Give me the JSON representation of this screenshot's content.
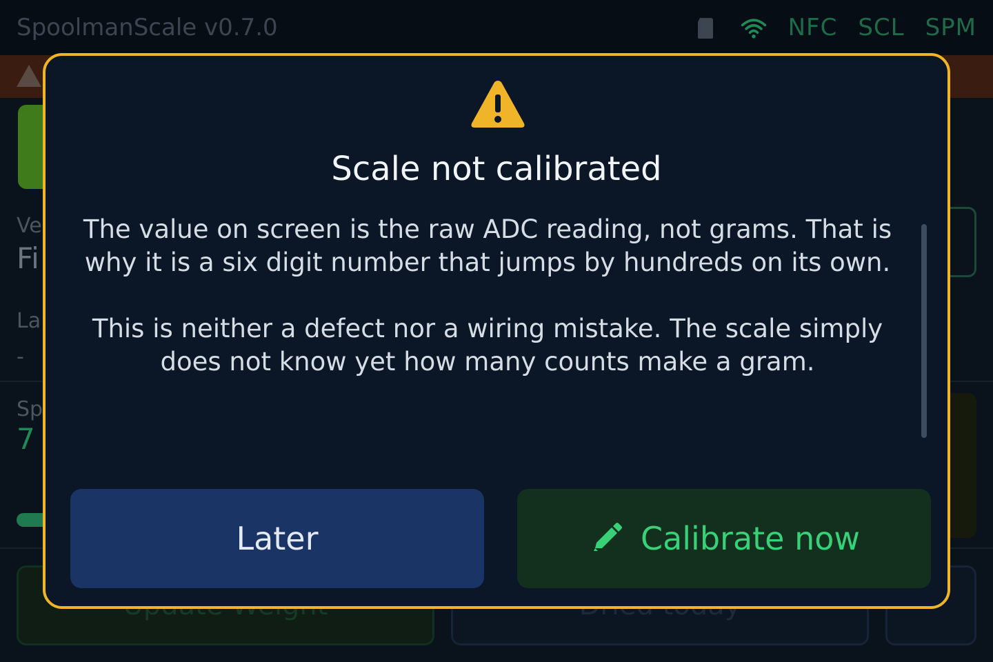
{
  "topbar": {
    "app_title": "SpoolmanScale v0.7.0",
    "status": [
      "NFC",
      "SCL",
      "SPM"
    ]
  },
  "icons": {
    "sd_card": "sd-card-icon",
    "wifi": "wifi-icon",
    "warning": "warning-icon",
    "pencil": "pencil-icon"
  },
  "colors": {
    "accent_warning": "#f0b429",
    "primary_button": "#1b3466",
    "success_button": "#13301f",
    "success_text": "#39d178",
    "status_green": "#1f6a48"
  },
  "background": {
    "vendor_label": "Ve",
    "vendor_value": "Fi",
    "last_label": "La",
    "last_value": "-",
    "spool_label": "Sp",
    "spool_value": "7",
    "update_weight_label": "Update Weight",
    "dried_today_label": "Dried today"
  },
  "modal": {
    "title": "Scale not calibrated",
    "paragraph_1": "The value on screen is the raw ADC reading, not grams. That is why it is a six digit number that jumps by hundreds on its own.",
    "paragraph_2": "This is neither a defect nor a wiring mistake. The scale simply does not know yet how many counts make a gram.",
    "later_label": "Later",
    "calibrate_label": "Calibrate now"
  }
}
